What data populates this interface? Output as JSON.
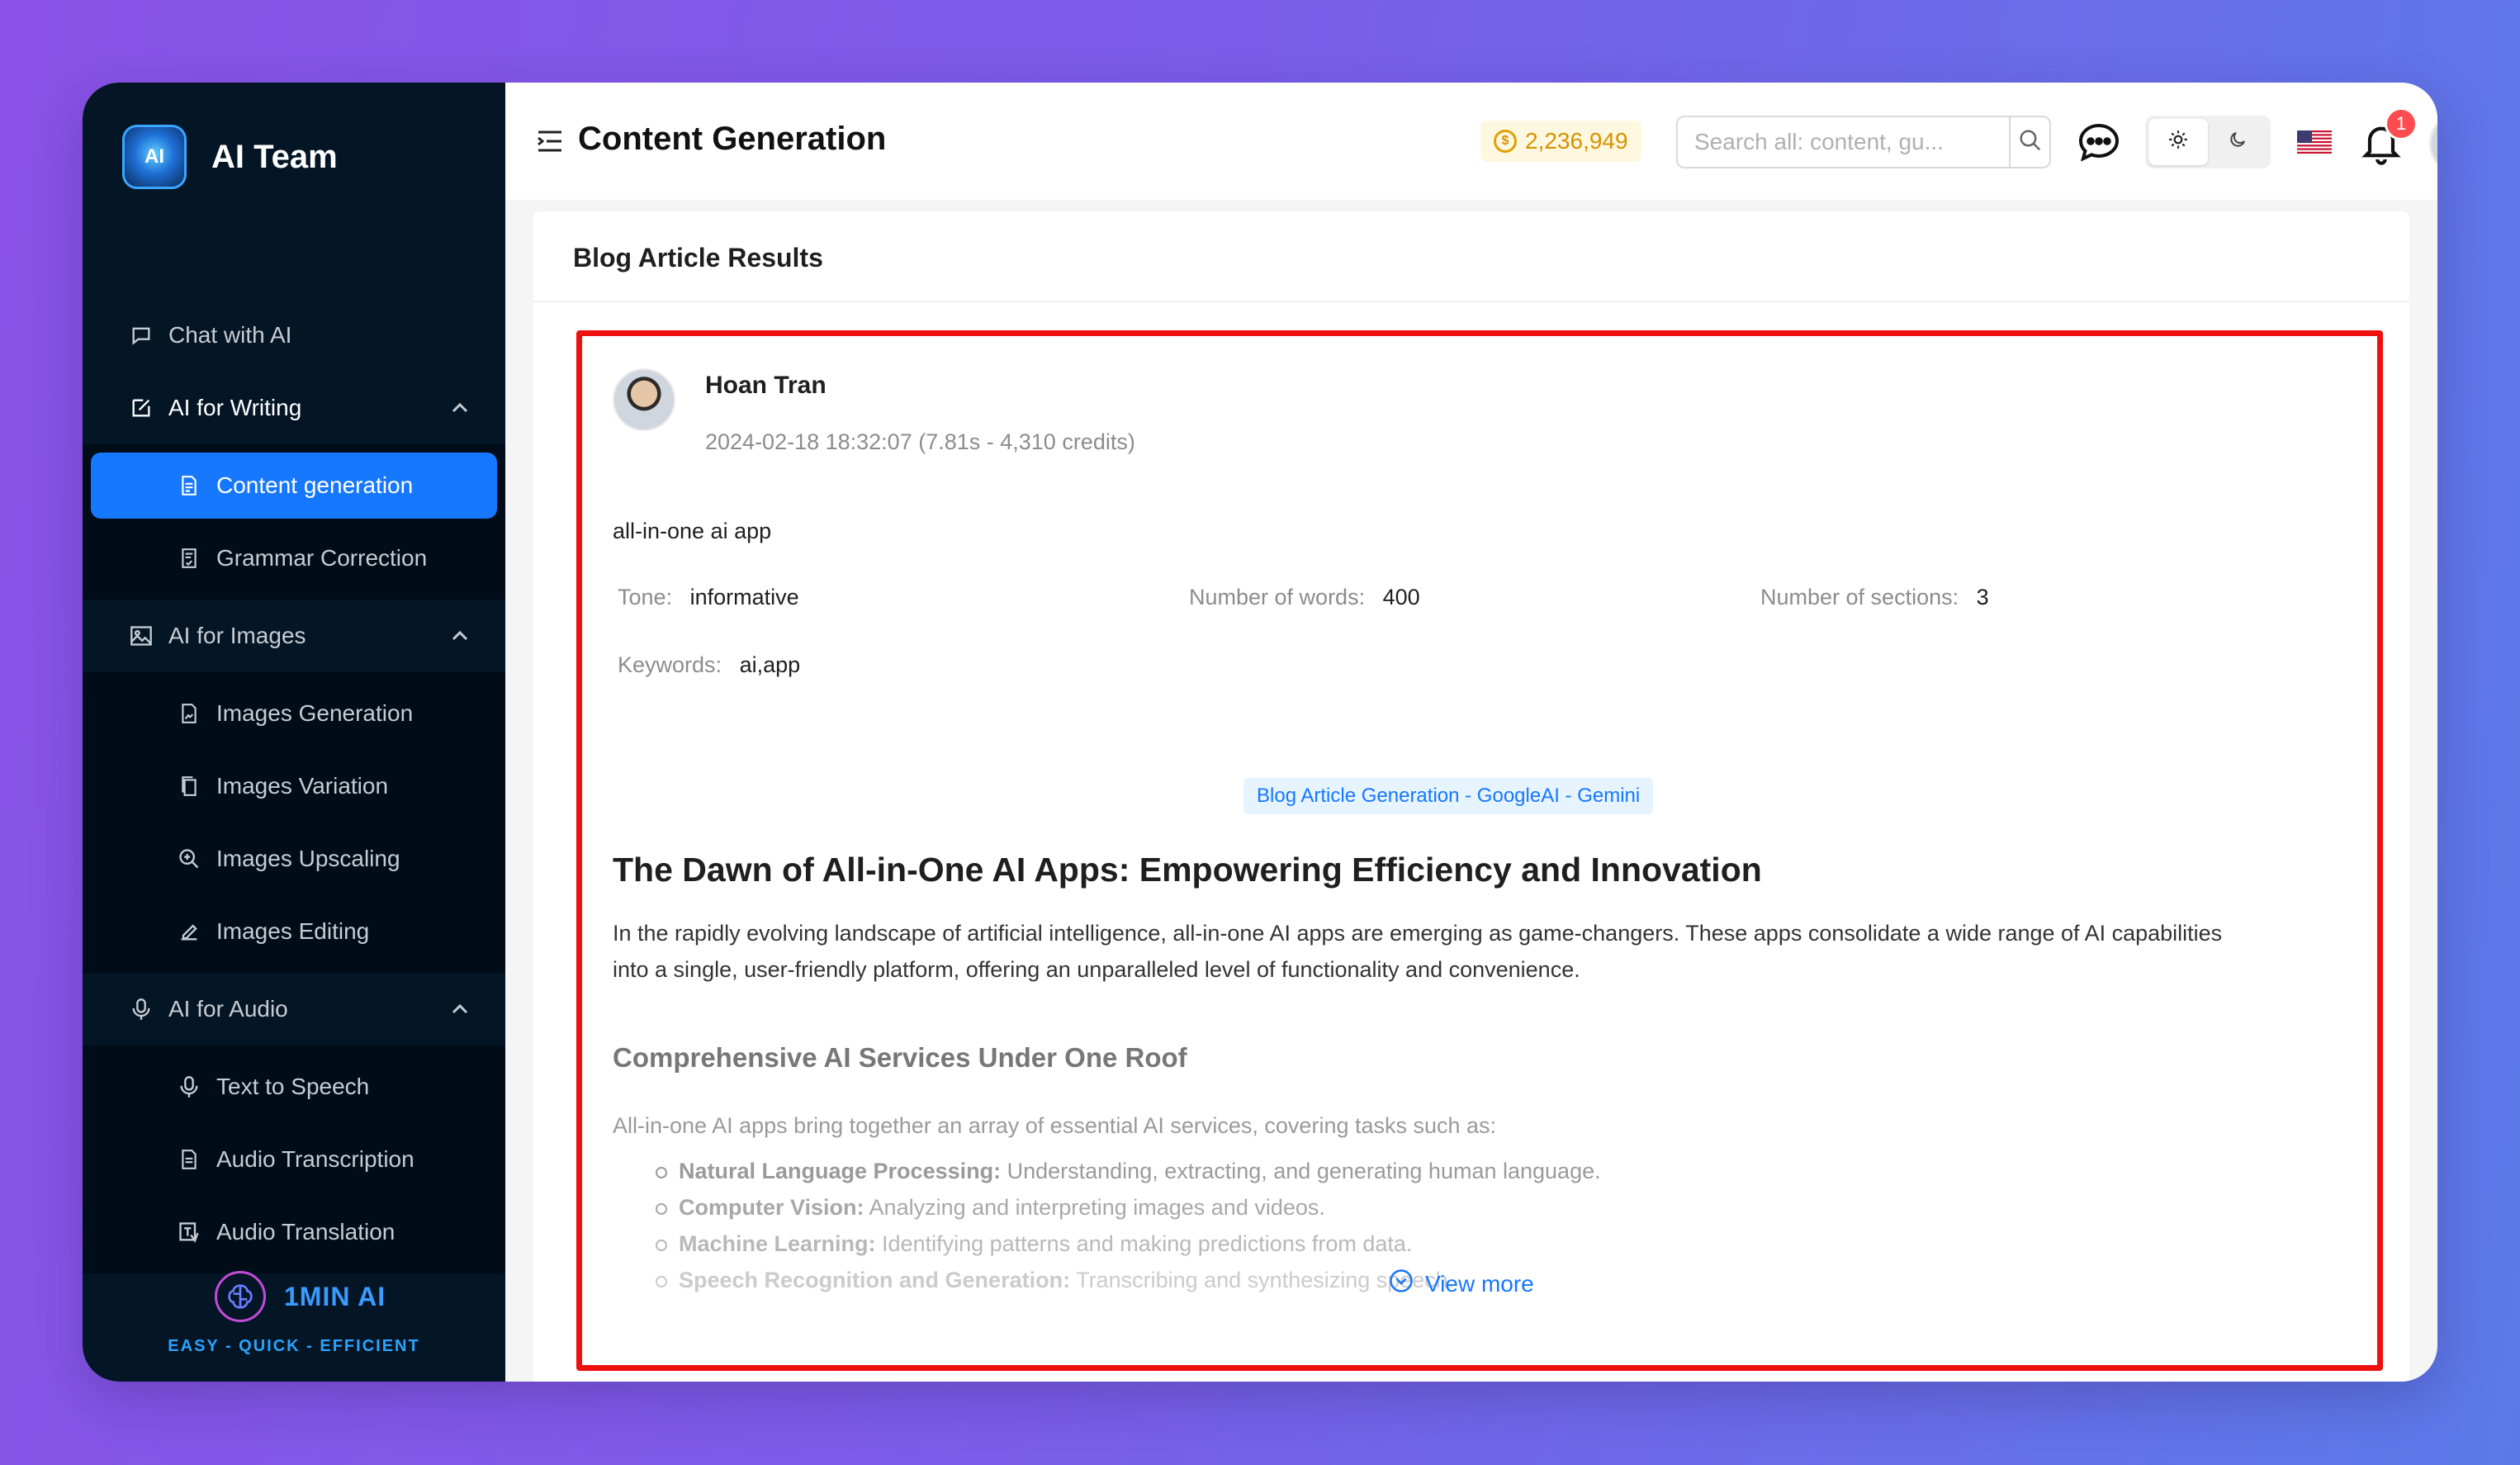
{
  "app": {
    "name": "AI Team",
    "logo_text": "AI"
  },
  "sidebar": {
    "sections": [
      {
        "label": "Chat with AI",
        "icon": "chat-icon"
      },
      {
        "label": "AI for Writing",
        "icon": "edit-icon",
        "expanded": true,
        "items": [
          {
            "label": "Content generation",
            "icon": "document-icon",
            "selected": true
          },
          {
            "label": "Grammar Correction",
            "icon": "document-check-icon"
          }
        ]
      },
      {
        "label": "AI for Images",
        "icon": "image-icon",
        "expanded": true,
        "items": [
          {
            "label": "Images Generation",
            "icon": "file-image-icon"
          },
          {
            "label": "Images Variation",
            "icon": "copy-icon"
          },
          {
            "label": "Images Upscaling",
            "icon": "zoom-in-icon"
          },
          {
            "label": "Images Editing",
            "icon": "pencil-icon"
          }
        ]
      },
      {
        "label": "AI for Audio",
        "icon": "microphone-icon",
        "expanded": true,
        "items": [
          {
            "label": "Text to Speech",
            "icon": "microphone-icon"
          },
          {
            "label": "Audio Transcription",
            "icon": "file-text-icon"
          },
          {
            "label": "Audio Translation",
            "icon": "translate-icon"
          }
        ]
      }
    ],
    "footer": {
      "brand": "1MIN AI",
      "tagline": "EASY - QUICK - EFFICIENT"
    }
  },
  "header": {
    "title": "Content Generation",
    "credits": "2,236,949",
    "search_placeholder": "Search all: content, gu...",
    "notification_count": "1",
    "theme_options": [
      "light",
      "dark"
    ],
    "theme_selected": "light"
  },
  "main": {
    "card_title": "Blog Article Results",
    "result": {
      "user_name": "Hoan Tran",
      "meta": "2024-02-18 18:32:07 (7.81s - 4,310 credits)",
      "prompt": "all-in-one ai app",
      "tone_label": "Tone",
      "tone_value": "informative",
      "words_label": "Number of words",
      "words_value": "400",
      "sections_label": "Number of sections",
      "sections_value": "3",
      "keywords_label": "Keywords",
      "keywords_value": "ai,app",
      "model_tag": "Blog Article Generation - GoogleAI - Gemini",
      "heading": "The Dawn of All-in-One AI Apps: Empowering Efficiency and Innovation",
      "paragraph": "In the rapidly evolving landscape of artificial intelligence, all-in-one AI apps are emerging as game-changers. These apps consolidate a wide range of AI capabilities into a single, user-friendly platform, offering an unparalleled level of functionality and convenience.",
      "subheading": "Comprehensive AI Services Under One Roof",
      "subparagraph": "All-in-one AI apps bring together an array of essential AI services, covering tasks such as:",
      "list": [
        {
          "term": "Natural Language Processing:",
          "desc": " Understanding, extracting, and generating human language."
        },
        {
          "term": "Computer Vision:",
          "desc": " Analyzing and interpreting images and videos."
        },
        {
          "term": "Machine Learning:",
          "desc": " Identifying patterns and making predictions from data."
        },
        {
          "term": "Speech Recognition and Generation:",
          "desc": " Transcribing and synthesizing speech."
        }
      ],
      "view_more": "View more"
    }
  },
  "colors": {
    "accent": "#1677ff",
    "sidebar_bg": "#041525",
    "highlight_border": "#ee0f0f",
    "credits": "#d89200",
    "badge": "#ff4d4f"
  }
}
